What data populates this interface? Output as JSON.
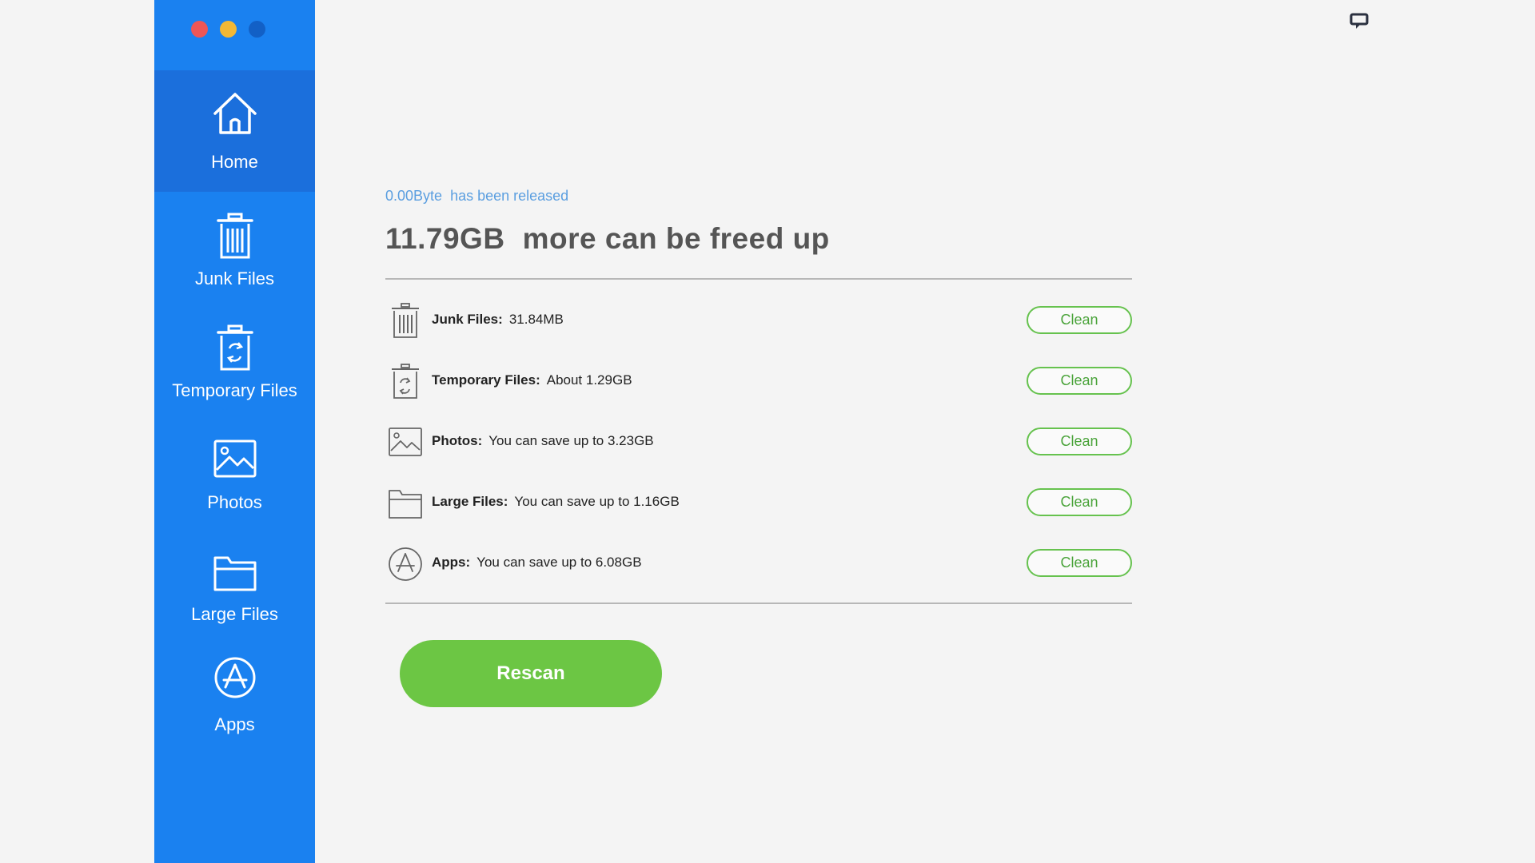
{
  "colors": {
    "sidebar": "#1a81f0",
    "sidebar_active": "#1b6fdc",
    "accent_green": "#6cc644",
    "released_text": "#5a9ee0",
    "window_close": "#ee5656",
    "window_minimize": "#f2b836",
    "window_maximize": "#1260c6"
  },
  "sidebar": {
    "items": [
      {
        "label": "Home",
        "icon": "home-icon",
        "active": true
      },
      {
        "label": "Junk Files",
        "icon": "trash-icon",
        "active": false
      },
      {
        "label": "Temporary Files",
        "icon": "temp-files-icon",
        "active": false
      },
      {
        "label": "Photos",
        "icon": "photo-icon",
        "active": false
      },
      {
        "label": "Large Files",
        "icon": "folder-icon",
        "active": false
      },
      {
        "label": "Apps",
        "icon": "app-store-icon",
        "active": false
      }
    ]
  },
  "summary": {
    "released_amount": "0.00Byte",
    "released_text": "has been released",
    "freeable_amount": "11.79GB",
    "freeable_text": "more can be freed up"
  },
  "categories": [
    {
      "name": "Junk Files:",
      "detail": "31.84MB",
      "icon": "trash-icon",
      "button": "Clean"
    },
    {
      "name": "Temporary Files:",
      "detail": "About 1.29GB",
      "icon": "temp-files-icon",
      "button": "Clean"
    },
    {
      "name": "Photos:",
      "detail": "You can save up to 3.23GB",
      "icon": "photo-icon",
      "button": "Clean"
    },
    {
      "name": "Large Files:",
      "detail": "You can save up to 1.16GB",
      "icon": "folder-icon",
      "button": "Clean"
    },
    {
      "name": "Apps:",
      "detail": "You can save up to 6.08GB",
      "icon": "app-store-icon",
      "button": "Clean"
    }
  ],
  "actions": {
    "rescan_label": "Rescan"
  },
  "top_bar": {
    "chat_icon": "chat-bubble-icon"
  }
}
